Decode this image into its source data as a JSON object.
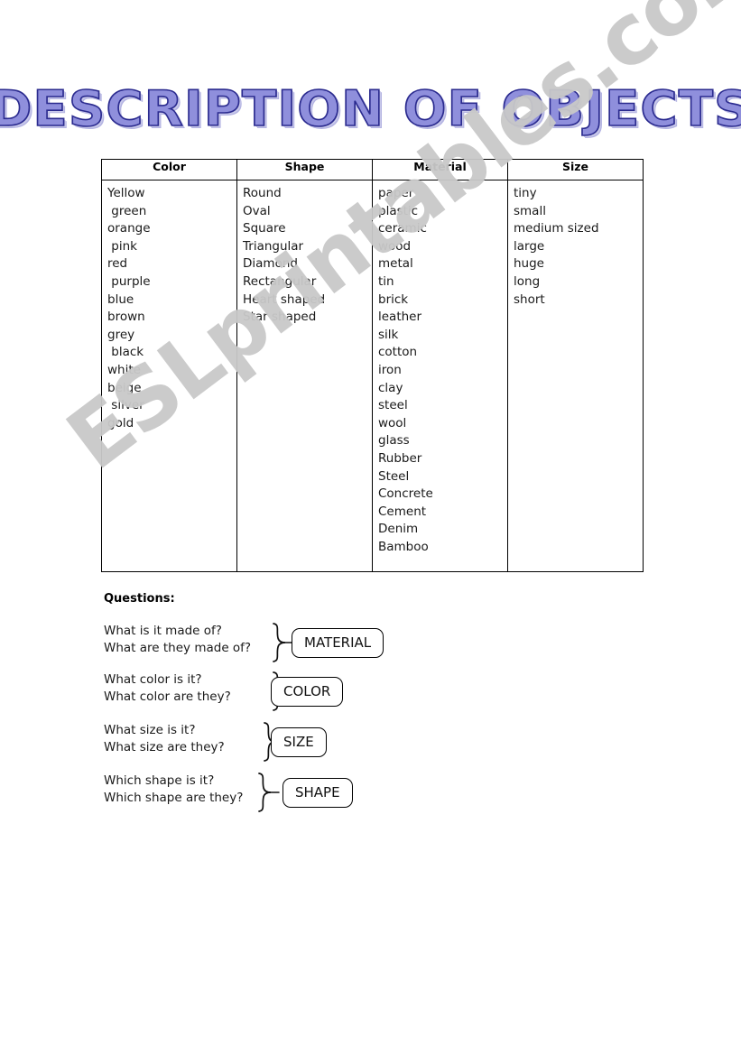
{
  "title": "DESCRIPTION OF OBJECTS",
  "watermark": "ESLprintables.com",
  "title_colors": {
    "fill": "#8f8fdc",
    "outline": "#2b2b8f",
    "shadow": "#b3b3e2"
  },
  "table": {
    "headers": [
      "Color",
      "Shape",
      "Material",
      "Size"
    ],
    "columns": [
      {
        "header": "Color",
        "items": [
          "Yellow",
          " green",
          "orange",
          " pink",
          "red",
          " purple",
          "blue",
          "brown",
          "grey",
          " black",
          "white",
          "beige",
          " silver",
          "gold"
        ]
      },
      {
        "header": "Shape",
        "items": [
          "Round",
          "Oval",
          "Square",
          "Triangular",
          "Diamond",
          "Rectangular",
          "Heart shaped",
          "Star shaped"
        ]
      },
      {
        "header": "Material",
        "items": [
          "paper",
          "plastic",
          "ceramic",
          "wood",
          "metal",
          "tin",
          "brick",
          "leather",
          "silk",
          "cotton",
          "iron",
          "clay",
          "steel",
          "wool",
          "glass",
          "Rubber",
          "Steel",
          "Concrete",
          "Cement",
          "Denim",
          "Bamboo"
        ]
      },
      {
        "header": "Size",
        "items": [
          "tiny",
          "small",
          "medium sized",
          "large",
          "huge",
          "long",
          "short"
        ]
      }
    ]
  },
  "questions": {
    "heading": "Questions:",
    "groups": [
      {
        "line1": "What is it made of?",
        "line2": "What are they made of?",
        "answer": "MATERIAL"
      },
      {
        "line1": "What color is it?",
        "line2": "What color are they?",
        "answer": "COLOR"
      },
      {
        "line1": "What size is it?",
        "line2": "What size are they?",
        "answer": "SIZE"
      },
      {
        "line1": "Which shape is it?",
        "line2": "Which shape are they?",
        "answer": "SHAPE"
      }
    ]
  }
}
